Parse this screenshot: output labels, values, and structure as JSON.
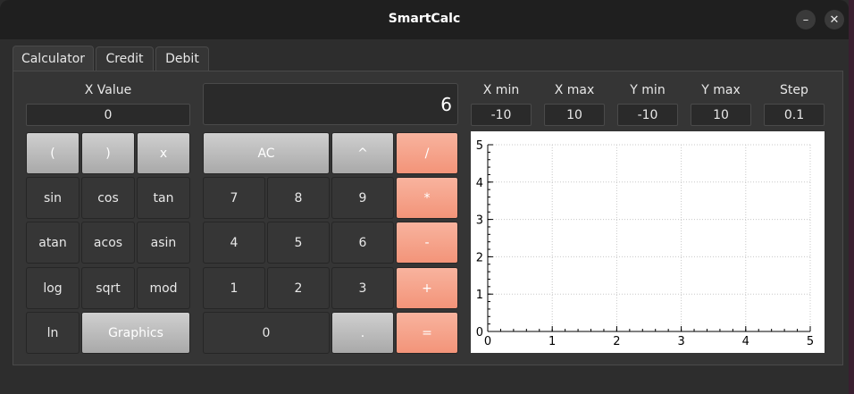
{
  "window": {
    "title": "SmartCalc",
    "minimize_icon": "–",
    "close_icon": "✕"
  },
  "tabs": [
    {
      "label": "Calculator"
    },
    {
      "label": "Credit"
    },
    {
      "label": "Debit"
    }
  ],
  "x_value": {
    "label": "X Value",
    "value": "0"
  },
  "display": {
    "value": "6"
  },
  "range": [
    {
      "label": "X min",
      "value": "-10"
    },
    {
      "label": "X max",
      "value": "10"
    },
    {
      "label": "Y min",
      "value": "-10"
    },
    {
      "label": "Y max",
      "value": "10"
    },
    {
      "label": "Step",
      "value": "0.1"
    }
  ],
  "buttons": {
    "lparen": "(",
    "rparen": ")",
    "x": "x",
    "sin": "sin",
    "cos": "cos",
    "tan": "tan",
    "atan": "atan",
    "acos": "acos",
    "asin": "asin",
    "log": "log",
    "sqrt": "sqrt",
    "mod": "mod",
    "ln": "ln",
    "graphics": "Graphics",
    "ac": "AC",
    "pow": "^",
    "div": "/",
    "d7": "7",
    "d8": "8",
    "d9": "9",
    "mul": "*",
    "d4": "4",
    "d5": "5",
    "d6": "6",
    "minus": "-",
    "d1": "1",
    "d2": "2",
    "d3": "3",
    "plus": "+",
    "d0": "0",
    "dot": ".",
    "eq": "="
  },
  "colors": {
    "operator_accent": "#f39479",
    "gray_button": "#bdbdbd"
  },
  "chart_data": {
    "type": "line",
    "series": [],
    "xlim": [
      0,
      5
    ],
    "ylim": [
      0,
      5
    ],
    "x_ticks": [
      "0",
      "1",
      "2",
      "3",
      "4",
      "5"
    ],
    "y_ticks": [
      "0",
      "1",
      "2",
      "3",
      "4",
      "5"
    ],
    "grid": true
  }
}
